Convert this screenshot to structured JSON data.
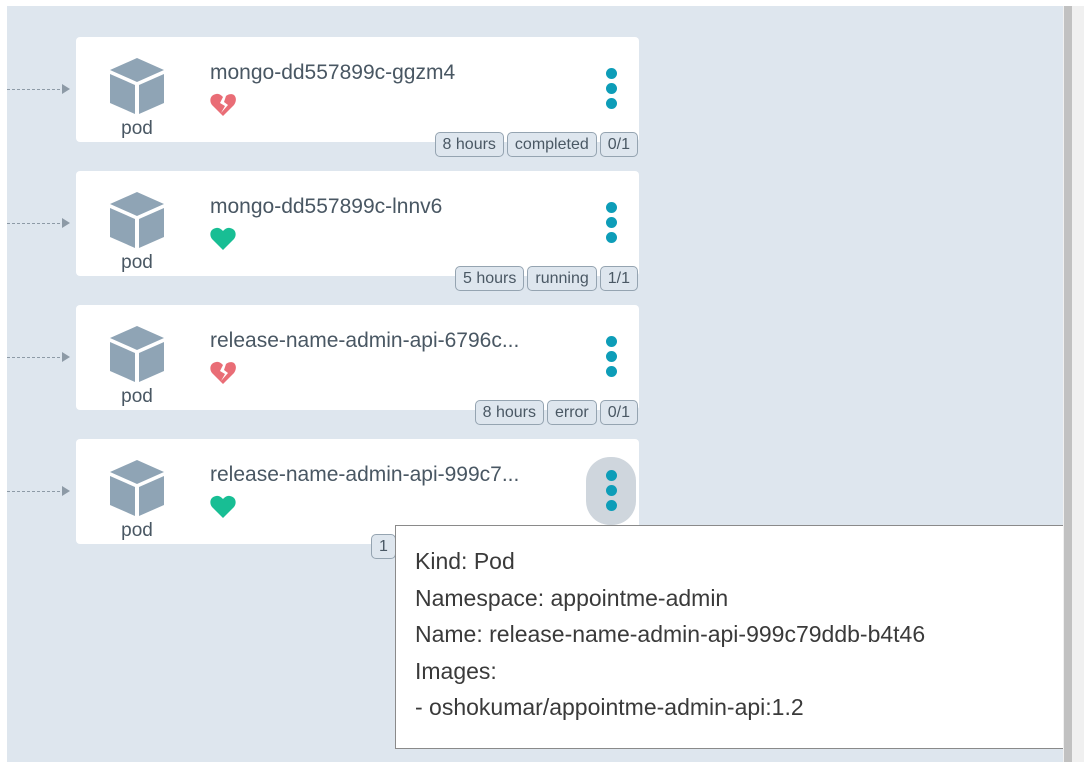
{
  "nodes": [
    {
      "name": "mongo-dd557899c-ggzm4",
      "kind_label": "pod",
      "health": "degraded",
      "tags": [
        "8 hours",
        "completed",
        "0/1"
      ]
    },
    {
      "name": "mongo-dd557899c-lnnv6",
      "kind_label": "pod",
      "health": "healthy",
      "tags": [
        "5 hours",
        "running",
        "1/1"
      ]
    },
    {
      "name": "release-name-admin-api-6796c...",
      "kind_label": "pod",
      "health": "degraded",
      "tags": [
        "8 hours",
        "error",
        "0/1"
      ]
    },
    {
      "name": "release-name-admin-api-999c7...",
      "kind_label": "pod",
      "health": "healthy",
      "tags": [
        "1"
      ]
    }
  ],
  "tooltip": {
    "kind": "Kind: Pod",
    "namespace": "Namespace: appointme-admin",
    "name": "Name: release-name-admin-api-999c79ddb-b4t46",
    "images_label": "Images:",
    "image": "- oshokumar/appointme-admin-api:1.2"
  },
  "colors": {
    "canvas": "#dee6ee",
    "pod_icon": "#8fa4b5",
    "healthy": "#18be94",
    "degraded": "#e96d76",
    "menu_dots": "#0d9db8"
  },
  "icons": {
    "pod": "cube-icon",
    "healthy": "heart-icon",
    "degraded": "broken-heart-icon",
    "menu": "kebab-menu-icon"
  }
}
